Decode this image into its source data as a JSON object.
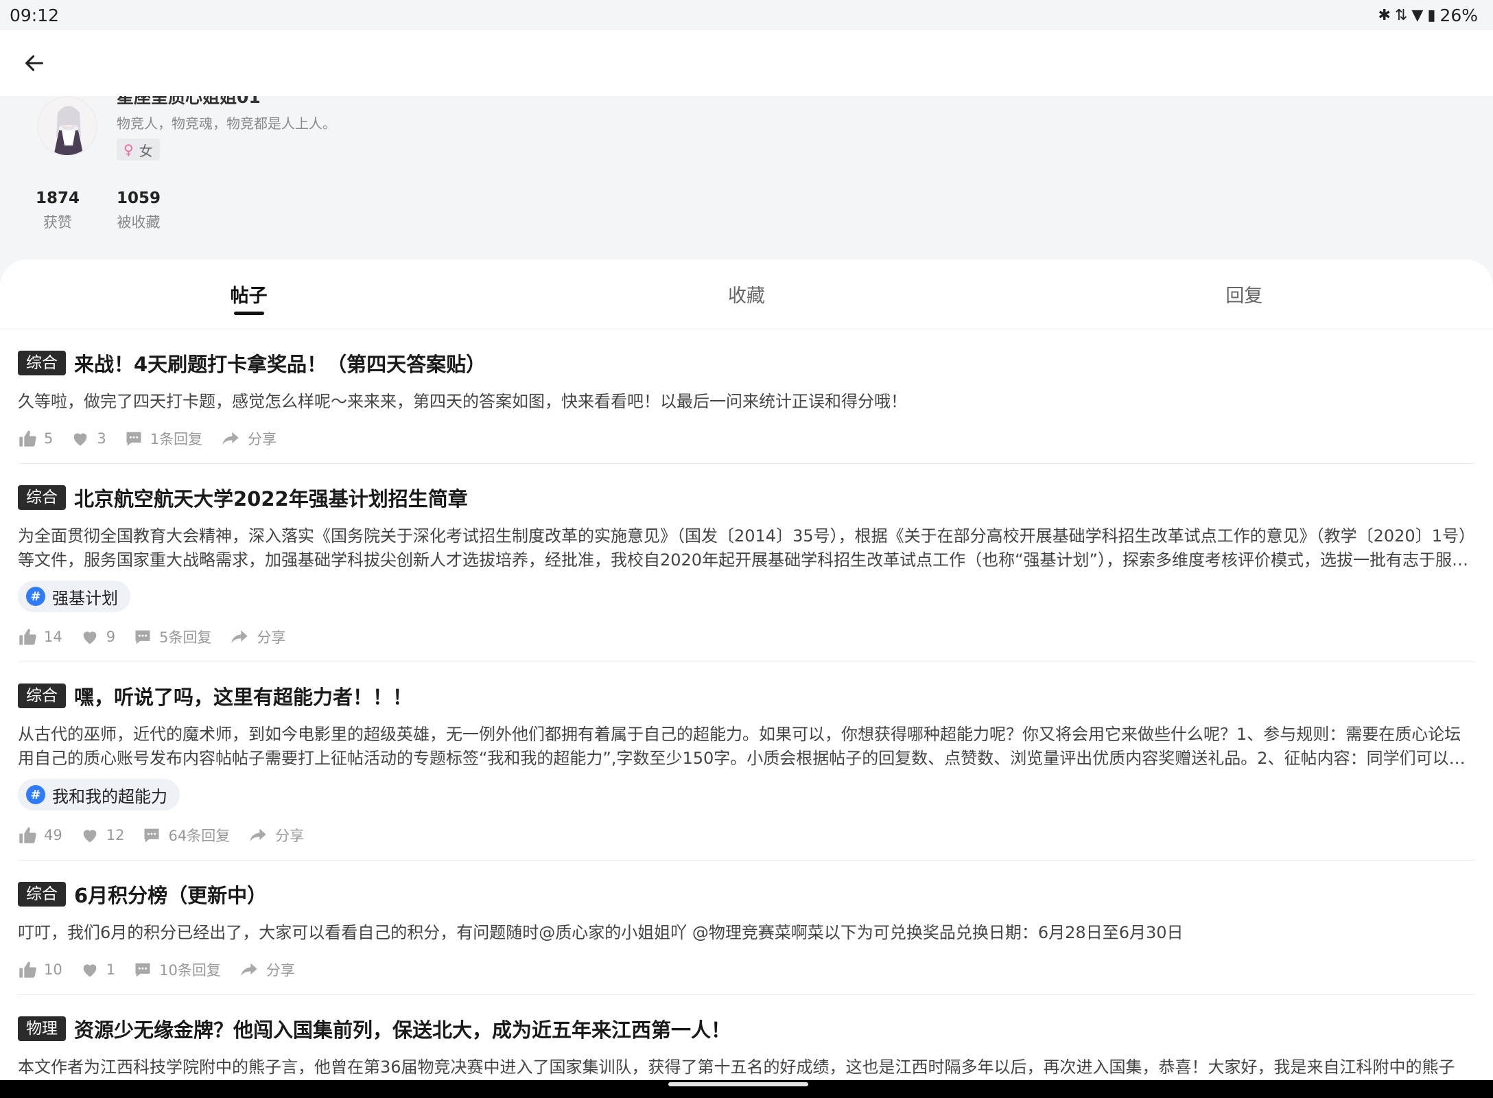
{
  "status_bar": {
    "time": "09:12",
    "battery": "26%"
  },
  "profile": {
    "username": "星座呈质心姐姐01",
    "bio": "物竞人，物竞魂，物竞都是人上人。",
    "gender": "女",
    "stats": [
      {
        "value": "1874",
        "label": "获赞"
      },
      {
        "value": "1059",
        "label": "被收藏"
      }
    ]
  },
  "tabs": [
    "帖子",
    "收藏",
    "回复"
  ],
  "posts": [
    {
      "category": "综合",
      "title": "来战！4天刷题打卡拿奖品！（第四天答案贴）",
      "body": "久等啦，做完了四天打卡题，感觉怎么样呢～来来来，第四天的答案如图，快来看看吧！以最后一问来统计正误和得分哦！",
      "likes": "5",
      "favorites": "3",
      "replies": "1条回复",
      "share": "分享"
    },
    {
      "category": "综合",
      "title": "北京航空航天大学2022年强基计划招生简章",
      "body": "为全面贯彻全国教育大会精神，深入落实《国务院关于深化考试招生制度改革的实施意见》（国发〔2014〕35号），根据《关于在部分高校开展基础学科招生改革试点工作的意见》（教学〔2020〕1号）等文件，服务国家重大战略需求，加强基础学科拔尖创新人才选拔培养，经批准，我校自2020年起开展基础学科招生改革试点工作（也称“强基计划”），探索多维度考核评价模式，选拔一批有志于服务国家重大战略需求且综合素质优秀或基础学科拔尖的学生。",
      "topic": "强基计划",
      "likes": "14",
      "favorites": "9",
      "replies": "5条回复",
      "share": "分享"
    },
    {
      "category": "综合",
      "title": "嘿，听说了吗，这里有超能力者！！！",
      "body": "从古代的巫师，近代的魔术师，到如今电影里的超级英雄，无一例外他们都拥有着属于自己的超能力。如果可以，你想获得哪种超能力呢？你又将会用它来做些什么呢？1、参与规则：需要在质心论坛用自己的质心账号发布内容帖帖子需要打上征帖活动的专题标签“我和我的超能力”,字数至少150字。小质会根据帖子的回复数、点赞数、浏览量评出优质内容奖赠送礼品。2、征帖内容：同学们可以畅所欲言。",
      "topic": "我和我的超能力",
      "likes": "49",
      "favorites": "12",
      "replies": "64条回复",
      "share": "分享"
    },
    {
      "category": "综合",
      "title": "6月积分榜（更新中）",
      "body": "叮叮，我们6月的积分已经出了，大家可以看看自己的积分，有问题随时@质心家的小姐姐吖 @物理竞赛菜啊菜以下为可兑换奖品兑换日期：6月28日至6月30日",
      "likes": "10",
      "favorites": "1",
      "replies": "10条回复",
      "share": "分享"
    },
    {
      "category": "物理",
      "title": "资源少无缘金牌？他闯入国集前列，保送北大，成为近五年来江西第一人！",
      "body": "本文作者为江西科技学院附中的熊子言，他曾在第36届物竞决赛中进入了国家集训队，获得了第十五名的好成绩，这也是江西时隔多年以后，再次进入国集，恭喜！大家好，我是来自江科附中的熊子言。由于江西初中并没有很浓厚的竞赛氛围，我是早接触竞赛，还是在中考前接触质心的知识点，但真正系统地学习竞赛，还要等到中考后，也可以说是进入高中后。中考后的暑假，我开始看……",
      "likes": "",
      "favorites": "",
      "replies": "",
      "share": "分享"
    }
  ]
}
